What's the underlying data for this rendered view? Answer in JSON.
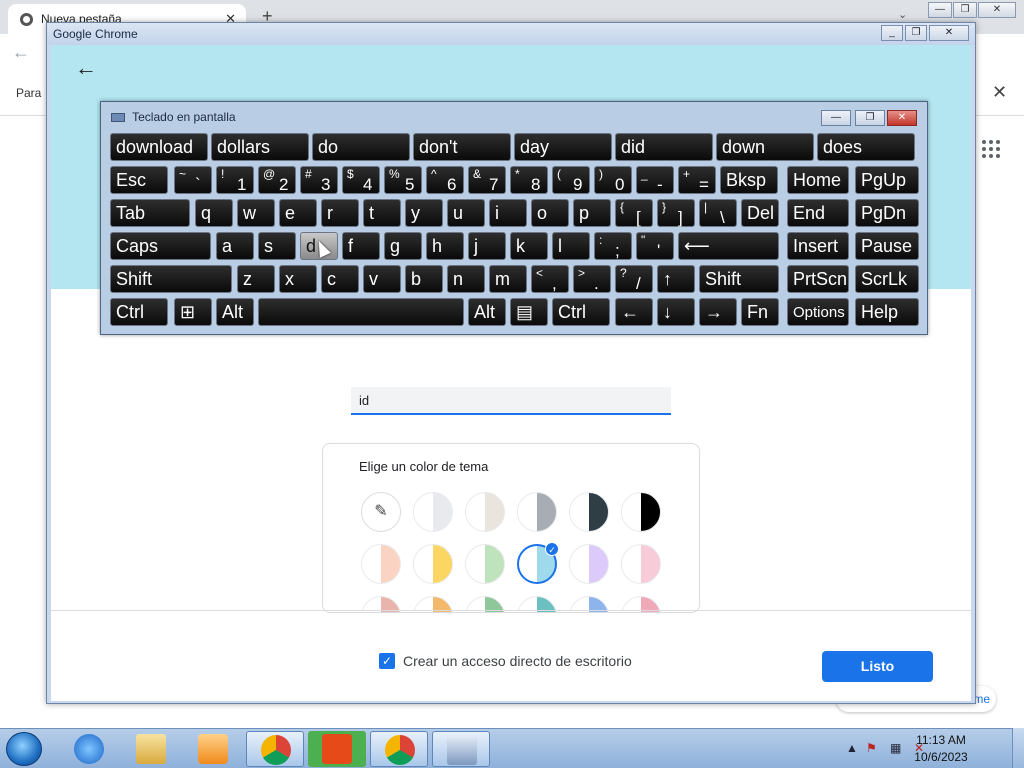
{
  "outer": {
    "tab_title": "Nueva pestaña",
    "bookmarks_prefix": "Para",
    "bottom_link_fragment": "me"
  },
  "dialog": {
    "window_title": "Google Chrome",
    "name_input_value": "id",
    "theme_title": "Elige un color de tema",
    "shortcut_label": "Crear un acceso directo de escritorio",
    "shortcut_checked": true,
    "done_label": "Listo",
    "swatch_colors_row1": [
      "#e8eaed",
      "#e9e4dd",
      "#a8acb3",
      "#2f3d45",
      "#000000"
    ],
    "swatch_colors_row2": [
      "#fbd3c2",
      "#fbd663",
      "#bfe3bc",
      "#9fd9ec",
      "#dccafb",
      "#f7cbd7"
    ],
    "swatch_colors_row3": [
      "#e8b4ac",
      "#f2b86b",
      "#8fc79a",
      "#6cc0c2",
      "#8eb4ec",
      "#f0a9b8"
    ],
    "selected_swatch": "light-blue"
  },
  "osk": {
    "title": "Teclado en pantalla",
    "predictions": [
      "download",
      "dollars",
      "do",
      "don't",
      "day",
      "did",
      "down",
      "does"
    ],
    "keys": [
      {
        "name": "esc",
        "label": "Esc"
      },
      {
        "name": "tilde",
        "shift": "~",
        "base": "`"
      },
      {
        "name": "1",
        "shift": "!",
        "base": "1"
      },
      {
        "name": "2",
        "shift": "@",
        "base": "2"
      },
      {
        "name": "3",
        "shift": "#",
        "base": "3"
      },
      {
        "name": "4",
        "shift": "$",
        "base": "4"
      },
      {
        "name": "5",
        "shift": "%",
        "base": "5"
      },
      {
        "name": "6",
        "shift": "^",
        "base": "6"
      },
      {
        "name": "7",
        "shift": "&",
        "base": "7"
      },
      {
        "name": "8",
        "shift": "*",
        "base": "8"
      },
      {
        "name": "9",
        "shift": "(",
        "base": "9"
      },
      {
        "name": "0",
        "shift": ")",
        "base": "0"
      },
      {
        "name": "minus",
        "shift": "_",
        "base": "-"
      },
      {
        "name": "equals",
        "shift": "+",
        "base": "="
      },
      {
        "name": "backspace",
        "label": "Bksp"
      },
      {
        "name": "home",
        "label": "Home"
      },
      {
        "name": "pgup",
        "label": "PgUp"
      },
      {
        "name": "tab",
        "label": "Tab"
      },
      {
        "name": "q",
        "label": "q"
      },
      {
        "name": "w",
        "label": "w"
      },
      {
        "name": "e",
        "label": "e"
      },
      {
        "name": "r",
        "label": "r"
      },
      {
        "name": "t",
        "label": "t"
      },
      {
        "name": "y",
        "label": "y"
      },
      {
        "name": "u",
        "label": "u"
      },
      {
        "name": "i",
        "label": "i"
      },
      {
        "name": "o",
        "label": "o"
      },
      {
        "name": "p",
        "label": "p"
      },
      {
        "name": "lbracket",
        "shift": "{",
        "base": "["
      },
      {
        "name": "rbracket",
        "shift": "}",
        "base": "]"
      },
      {
        "name": "backslash",
        "shift": "|",
        "base": "\\"
      },
      {
        "name": "del",
        "label": "Del"
      },
      {
        "name": "end",
        "label": "End"
      },
      {
        "name": "pgdn",
        "label": "PgDn"
      },
      {
        "name": "caps",
        "label": "Caps"
      },
      {
        "name": "a",
        "label": "a"
      },
      {
        "name": "s",
        "label": "s"
      },
      {
        "name": "d",
        "label": "d"
      },
      {
        "name": "f",
        "label": "f"
      },
      {
        "name": "g",
        "label": "g"
      },
      {
        "name": "h",
        "label": "h"
      },
      {
        "name": "j",
        "label": "j"
      },
      {
        "name": "k",
        "label": "k"
      },
      {
        "name": "l",
        "label": "l"
      },
      {
        "name": "semicolon",
        "shift": ":",
        "base": ";"
      },
      {
        "name": "quote",
        "shift": "\"",
        "base": "'"
      },
      {
        "name": "enter",
        "label": "⟵"
      },
      {
        "name": "insert",
        "label": "Insert"
      },
      {
        "name": "pause",
        "label": "Pause"
      },
      {
        "name": "lshift",
        "label": "Shift"
      },
      {
        "name": "z",
        "label": "z"
      },
      {
        "name": "x",
        "label": "x"
      },
      {
        "name": "c",
        "label": "c"
      },
      {
        "name": "v",
        "label": "v"
      },
      {
        "name": "b",
        "label": "b"
      },
      {
        "name": "n",
        "label": "n"
      },
      {
        "name": "m",
        "label": "m"
      },
      {
        "name": "comma",
        "shift": "<",
        "base": ","
      },
      {
        "name": "period",
        "shift": ">",
        "base": "."
      },
      {
        "name": "slash",
        "shift": "?",
        "base": "/"
      },
      {
        "name": "up",
        "label": "↑"
      },
      {
        "name": "rshift",
        "label": "Shift"
      },
      {
        "name": "prtscn",
        "label": "PrtScn"
      },
      {
        "name": "scrlk",
        "label": "ScrLk"
      },
      {
        "name": "lctrl",
        "label": "Ctrl"
      },
      {
        "name": "win",
        "label": "⊞"
      },
      {
        "name": "lalt",
        "label": "Alt"
      },
      {
        "name": "space",
        "label": ""
      },
      {
        "name": "ralt",
        "label": "Alt"
      },
      {
        "name": "menu",
        "label": "▤"
      },
      {
        "name": "rctrl",
        "label": "Ctrl"
      },
      {
        "name": "left",
        "label": "←"
      },
      {
        "name": "down",
        "label": "↓"
      },
      {
        "name": "right",
        "label": "→"
      },
      {
        "name": "fn",
        "label": "Fn"
      },
      {
        "name": "options",
        "label": "Options"
      },
      {
        "name": "help",
        "label": "Help"
      }
    ],
    "hovered_key": "d"
  },
  "taskbar": {
    "time": "11:13 AM",
    "date": "10/6/2023"
  }
}
